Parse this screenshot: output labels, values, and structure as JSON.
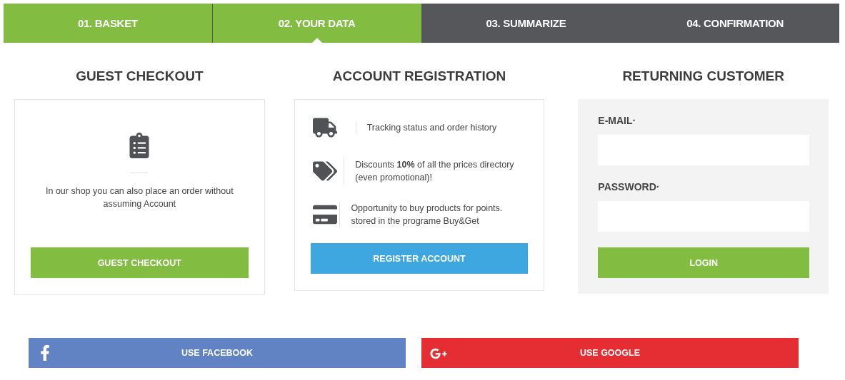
{
  "steps": [
    {
      "label": "01. BASKET",
      "completed": true,
      "selected": false
    },
    {
      "label": "02. YOUR DATA",
      "completed": true,
      "selected": true
    },
    {
      "label": "03. SUMMARIZE",
      "completed": false,
      "selected": false
    },
    {
      "label": "04. CONFIRMATION",
      "completed": false,
      "selected": false
    }
  ],
  "guest": {
    "title": "GUEST CHECKOUT",
    "text": "In our shop you can also place an order without assuming Account",
    "button": "GUEST CHECKOUT"
  },
  "registration": {
    "title": "ACCOUNT REGISTRATION",
    "benefits": [
      {
        "kind": "truck",
        "text": "Tracking status and order history"
      },
      {
        "kind": "tag",
        "text": "Discounts **10%** of all the prices directory (even promotional)!"
      },
      {
        "kind": "cards",
        "text": "Opportunity to buy products for points. stored in the programe Buy&Get"
      }
    ],
    "button": "REGISTER ACCOUNT"
  },
  "returning": {
    "title": "RETURNING CUSTOMER",
    "fields": [
      {
        "label": "E-MAIL·"
      },
      {
        "label": "PASSWORD·"
      }
    ],
    "button": "LOGIN"
  },
  "social": [
    {
      "kind": "facebook",
      "label": "USE FACEBOOK"
    },
    {
      "kind": "google",
      "label": "USE GOOGLE"
    }
  ]
}
